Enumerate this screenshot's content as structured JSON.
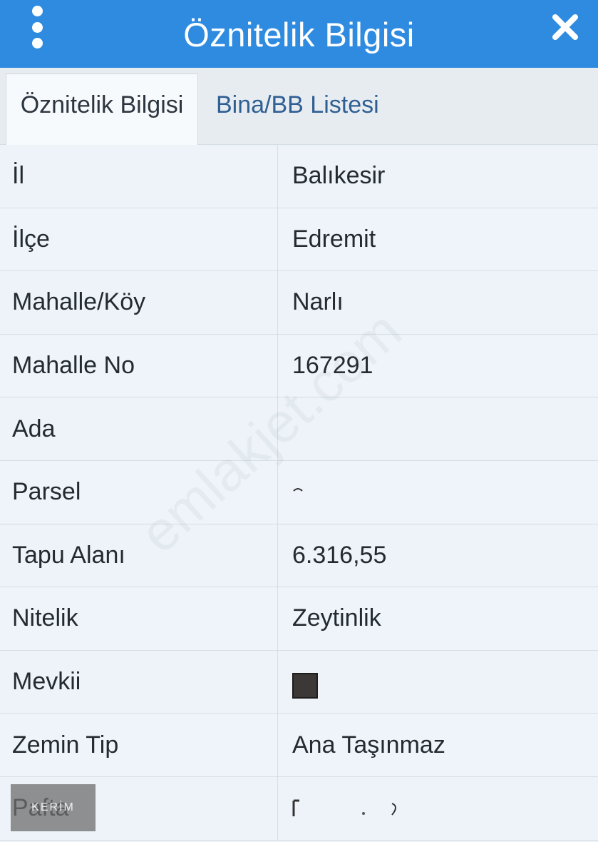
{
  "header": {
    "title": "Öznitelik Bilgisi",
    "menu_icon": "kebab-menu-icon",
    "close_icon": "close-icon",
    "bg_color": "#2e8be0"
  },
  "tabs": [
    {
      "label": "Öznitelik Bilgisi",
      "active": true
    },
    {
      "label": "Bina/BB Listesi",
      "active": false
    }
  ],
  "rows": [
    {
      "label": "İl",
      "value": "Balıkesir"
    },
    {
      "label": "İlçe",
      "value": "Edremit"
    },
    {
      "label": "Mahalle/Köy",
      "value": "Narlı"
    },
    {
      "label": "Mahalle No",
      "value": "167291"
    },
    {
      "label": "Ada",
      "value": ""
    },
    {
      "label": "Parsel",
      "value": ""
    },
    {
      "label": "Tapu Alanı",
      "value": "6.316,55"
    },
    {
      "label": "Nitelik",
      "value": "Zeytinlik"
    },
    {
      "label": "Mevkii",
      "value": ""
    },
    {
      "label": "Zemin Tip",
      "value": "Ana Taşınmaz"
    },
    {
      "label": "Pafta",
      "value": ""
    }
  ],
  "watermark": "emlakjet.com",
  "corner_logo": "KERİM"
}
